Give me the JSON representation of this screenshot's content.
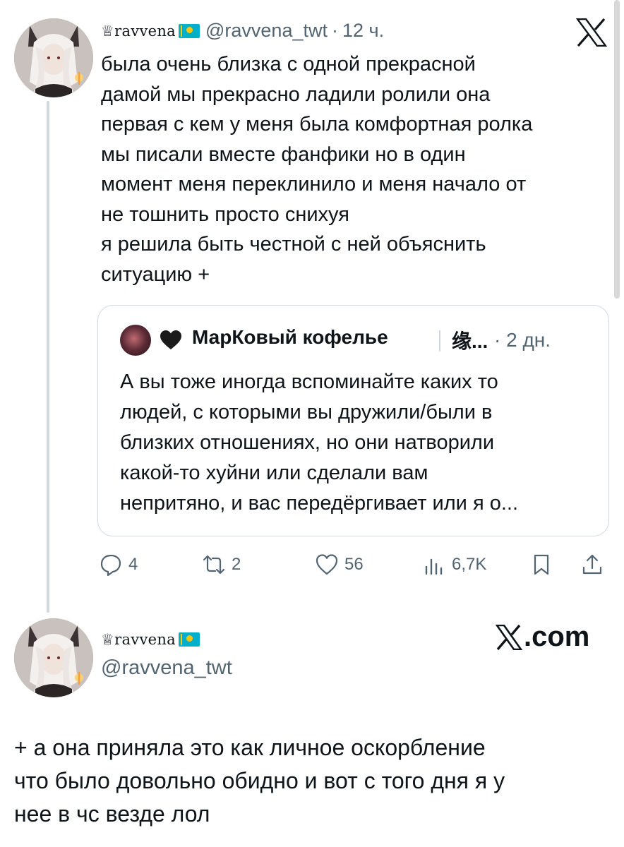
{
  "tweet": {
    "display_name": "♕ravvena",
    "handle": "@ravvena_twt",
    "separator": "·",
    "time": "12 ч.",
    "text": "была очень близка с одной прекрасной\nдамой мы прекрасно ладили ролили она\nпервая с кем у меня была комфортная ролка\nмы писали вместе фанфики но в один\nмомент меня переклинило и меня начало от\nне тошнить просто снихуя\nя решила быть честной с ней объяснить\nситуацию +",
    "flag_icon": "kazakhstan-flag-icon",
    "platform_icon": "x-logo-icon"
  },
  "quote": {
    "author_name": "МарКовый кофелье",
    "author_extra": "缘...",
    "separator": "·",
    "time": "2 дн.",
    "heart_icon": "black-heart-icon",
    "text": "А вы тоже иногда вспоминайте каких то\nлюдей, с которыми вы дружили/были в\nблизких отношениях, но они натворили\nкакой-то хуйни или сделали вам\nнепритяно, и вас передёргивает или я о..."
  },
  "actions": {
    "replies": "4",
    "retweets": "2",
    "likes": "56",
    "views": "6,7K",
    "icons": [
      "reply-icon",
      "retweet-icon",
      "like-icon",
      "views-icon",
      "bookmark-icon",
      "share-icon"
    ]
  },
  "reply_card": {
    "display_name": "♕ravvena",
    "handle": "@ravvena_twt",
    "brand": ".com",
    "text": "+ а она приняла это как личное оскорбление\nчто было довольно обидно и вот с того дня я у\nнее в чс везде лол"
  },
  "colors": {
    "text": "#0f1419",
    "secondary": "#536471",
    "border": "#cfd9de",
    "flag_blue": "#00AFCA",
    "flag_gold": "#FEC50C"
  }
}
